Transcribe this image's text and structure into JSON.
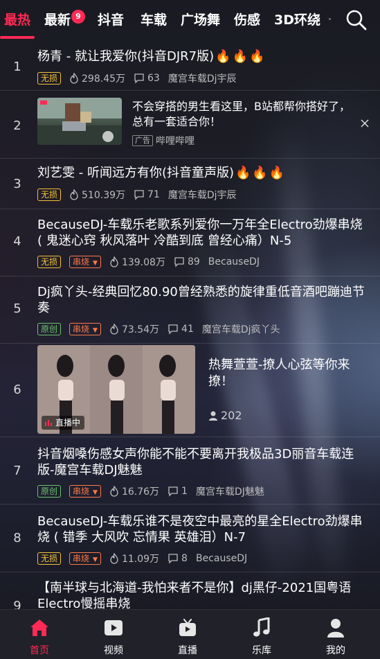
{
  "top_tabs": [
    {
      "label": "最热",
      "active": true
    },
    {
      "label": "最新",
      "badge": "9"
    },
    {
      "label": "抖音"
    },
    {
      "label": "车载"
    },
    {
      "label": "广场舞"
    },
    {
      "label": "伤感"
    },
    {
      "label": "3D环绕"
    }
  ],
  "rows": [
    {
      "no": "1",
      "title": "杨青 - 就让我爱你(抖音DJR7版)",
      "tags": [
        "无损"
      ],
      "plays": "298.45万",
      "comments": "63",
      "uploader": "魔宫车载Dj宇辰",
      "hot": true
    },
    {
      "no": "2",
      "ad": {
        "text": "不会穿搭的男生看这里，B站都帮你搭好了，总有一套适合你！",
        "tag": "广告",
        "source": "哔哩哔哩"
      }
    },
    {
      "no": "3",
      "title": "刘艺雯 - 听闻远方有你(抖音童声版)",
      "tags": [
        "无损"
      ],
      "plays": "510.39万",
      "comments": "71",
      "uploader": "魔宫车载Dj宇辰",
      "hot": true
    },
    {
      "no": "4",
      "title": "BecauseDJ-车载乐老歌系列爱你一万年全Electro劲爆串烧 ( 鬼迷心窍 秋风落叶 冷酷到底 曾经心痛）N-5",
      "tags": [
        "无损",
        "串烧"
      ],
      "plays": "139.08万",
      "comments": "89",
      "uploader": "BecauseDJ"
    },
    {
      "no": "5",
      "title": "Dj疯丫头-经典回忆80.90曾经熟悉的旋律重低音酒吧蹦迪节奏",
      "tags": [
        "原创",
        "串烧"
      ],
      "plays": "73.54万",
      "comments": "41",
      "uploader": "魔宫车载Dj疯丫头"
    },
    {
      "no": "6",
      "live": {
        "title": "热舞萱萱-撩人心弦等你来撩！",
        "badge": "直播中",
        "viewers": "202"
      }
    },
    {
      "no": "7",
      "title": "抖音烟嗓伤感女声你能不能不要离开我极品3D丽音车载连版-魔宫车载DJ魅魅",
      "tags": [
        "原创",
        "串烧"
      ],
      "plays": "16.76万",
      "comments": "1",
      "uploader": "魔宫车载DJ魅魅"
    },
    {
      "no": "8",
      "title": "BecauseDJ-车载乐谁不是夜空中最亮的星全Electro劲爆串烧 ( 错季 大风吹 忘情果 英雄泪）N-7",
      "tags": [
        "无损",
        "串烧"
      ],
      "plays": "11.09万",
      "comments": "8",
      "uploader": "BecauseDJ"
    },
    {
      "no": "9",
      "title": "【南半球与北海道-我怕来者不是你】dj黑仔-2021国粤语Electro慢摇串烧"
    }
  ],
  "bottom_nav": [
    {
      "label": "首页",
      "icon": "home-icon",
      "active": true
    },
    {
      "label": "视频",
      "icon": "video-icon"
    },
    {
      "label": "直播",
      "icon": "live-tv-icon"
    },
    {
      "label": "乐库",
      "icon": "music-note-icon"
    },
    {
      "label": "我的",
      "icon": "profile-icon"
    }
  ],
  "colors": {
    "accent": "#ff2a55",
    "lossless": "#f4c23a",
    "original": "#6dc36d",
    "medley": "#ff7a4a"
  }
}
